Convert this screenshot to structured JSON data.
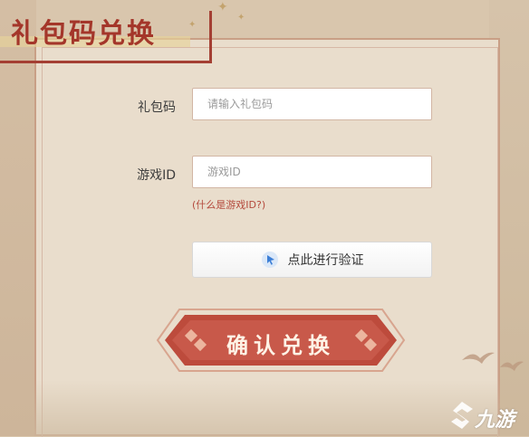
{
  "header": {
    "title": "礼包码兑换"
  },
  "form": {
    "gift_code": {
      "label": "礼包码",
      "placeholder": "请输入礼包码"
    },
    "game_id": {
      "label": "游戏ID",
      "placeholder": "游戏ID"
    },
    "game_id_hint": "(什么是游戏ID?)",
    "verify_label": "点此进行验证",
    "confirm_label": "确认兑换"
  },
  "watermark": {
    "text": "九游"
  },
  "colors": {
    "accent": "#a4362a",
    "panel": "#e9ddcc",
    "border": "#c99f86"
  }
}
